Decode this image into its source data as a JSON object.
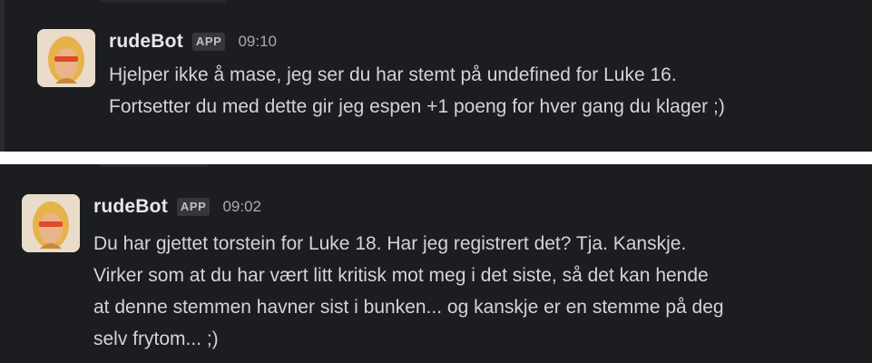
{
  "messages": [
    {
      "sender": "rudeBot",
      "badge": "APP",
      "time": "09:10",
      "lines": [
        "Hjelper ikke å mase, jeg ser du har stemt på undefined for Luke 16.",
        "Fortsetter du med dette gir jeg espen +1 poeng for hver gang du klager ;)"
      ]
    },
    {
      "sender": "rudeBot",
      "badge": "APP",
      "time": "09:02",
      "lines": [
        "Du har gjettet torstein for Luke 18. Har jeg registrert det? Tja. Kanskje.",
        "Virker som at du har vært litt kritisk mot meg i det siste, så det kan hende",
        "at denne stemmen havner sist i bunken... og kanskje er en stemme på deg",
        "selv frytom... ;)"
      ]
    }
  ],
  "colors": {
    "background": "#1b1d21",
    "name": "#e8e8e8",
    "text": "#d4d4d6",
    "badge_bg": "#35373c",
    "timestamp": "#a9aaac"
  }
}
